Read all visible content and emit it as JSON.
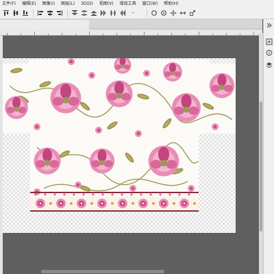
{
  "menu": {
    "items": [
      "文件(F)",
      "编辑(E)",
      "图像(I)",
      "图层(L)",
      "3D(D)",
      "视图(V)",
      "增效工具",
      "窗口(W)",
      "帮助(H)"
    ]
  },
  "options_bar": {
    "tools": [
      "align-top-icon",
      "align-vcenter-icon",
      "align-bottom-icon",
      "align-left-icon",
      "align-hcenter-icon",
      "align-right-icon",
      "distribute-top-icon",
      "distribute-vcenter-icon",
      "distribute-bottom-icon",
      "distribute-left-icon",
      "distribute-hcenter-icon",
      "distribute-right-icon",
      "more-options-icon",
      "3d-rotate-icon",
      "3d-roll-icon",
      "3d-drag-icon",
      "3d-slide-icon",
      "3d-scale-icon"
    ],
    "more_label": "···"
  },
  "tabs": {
    "active_document": ""
  },
  "right_panel": {
    "icons": [
      "panel-toggle-icon",
      "history-icon",
      "info-icon",
      "layers-icon"
    ]
  },
  "canvas": {
    "background_color": "#5f5f5f",
    "artwork_colors": {
      "pink": "#e98db6",
      "magenta": "#c2457e",
      "olive": "#9a9a55",
      "gold": "#c9a85a",
      "deep_red": "#8b2a3a"
    }
  }
}
